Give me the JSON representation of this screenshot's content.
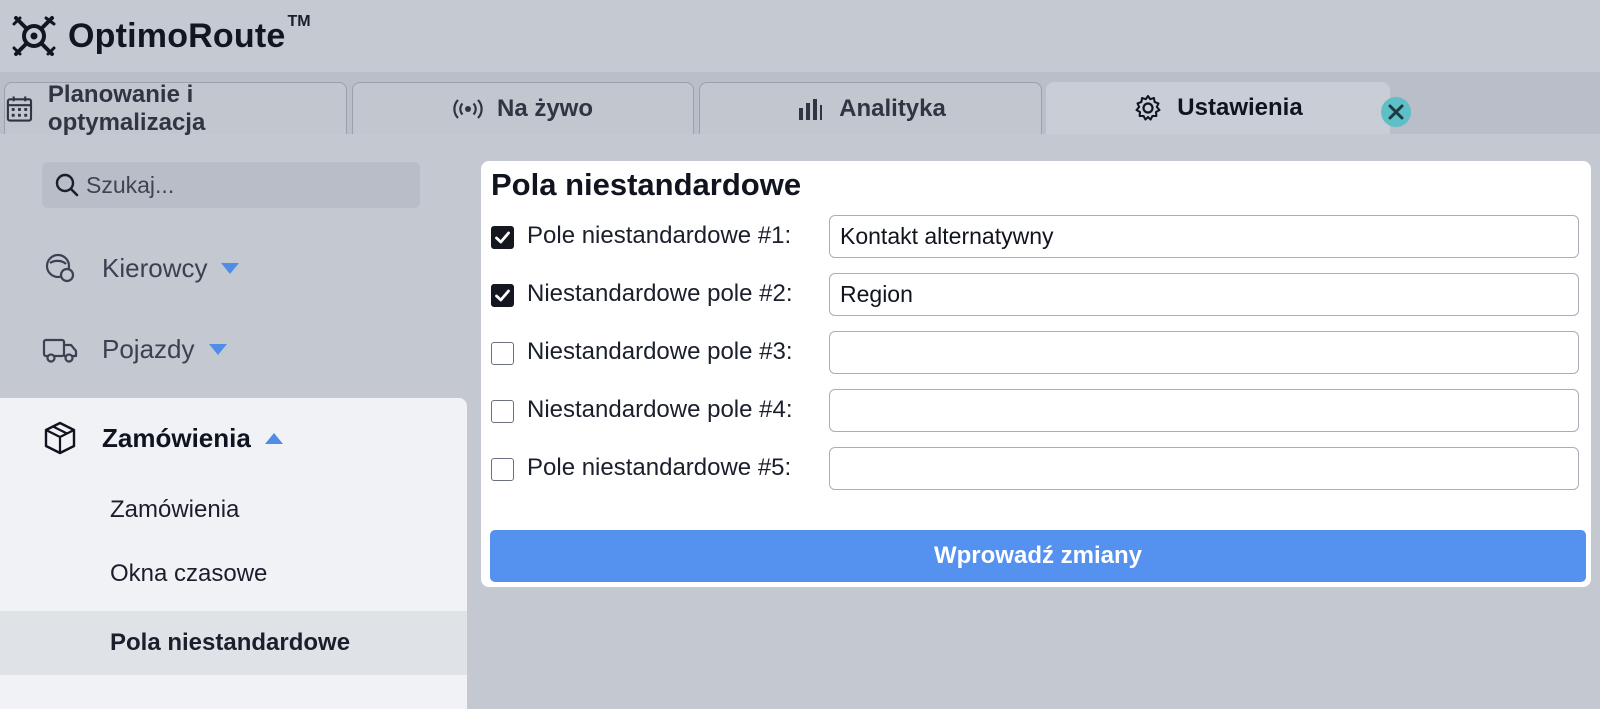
{
  "app": {
    "name": "OptimoRoute",
    "trademark": "TM"
  },
  "tabs": [
    {
      "label": "Planowanie i optymalizacja",
      "icon": "calendar-icon",
      "active": false
    },
    {
      "label": "Na żywo",
      "icon": "live-signal-icon",
      "active": false
    },
    {
      "label": "Analityka",
      "icon": "bar-chart-icon",
      "active": false
    },
    {
      "label": "Ustawienia",
      "icon": "gear-icon",
      "active": true
    }
  ],
  "sidebar": {
    "search_placeholder": "Szukaj...",
    "items": [
      {
        "label": "Kierowcy",
        "icon": "drivers-icon",
        "expanded": false
      },
      {
        "label": "Pojazdy",
        "icon": "truck-icon",
        "expanded": false
      },
      {
        "label": "Zamówienia",
        "icon": "package-icon",
        "expanded": true
      }
    ],
    "sub_items": [
      {
        "label": "Zamówienia",
        "active": false
      },
      {
        "label": "Okna czasowe",
        "active": false
      },
      {
        "label": "Pola niestandardowe",
        "active": true
      }
    ]
  },
  "panel": {
    "title": "Pola niestandardowe",
    "fields": [
      {
        "label": "Pole niestandardowe #1:",
        "checked": true,
        "value": "Kontakt alternatywny"
      },
      {
        "label": "Niestandardowe pole #2:",
        "checked": true,
        "value": "Region"
      },
      {
        "label": "Niestandardowe pole #3:",
        "checked": false,
        "value": ""
      },
      {
        "label": "Niestandardowe pole #4:",
        "checked": false,
        "value": ""
      },
      {
        "label": "Pole niestandardowe #5:",
        "checked": false,
        "value": ""
      }
    ],
    "submit_label": "Wprowadź zmiany"
  },
  "colors": {
    "accent": "#5591ee",
    "caret": "#4f8de6",
    "close": "#5fbfc6"
  }
}
